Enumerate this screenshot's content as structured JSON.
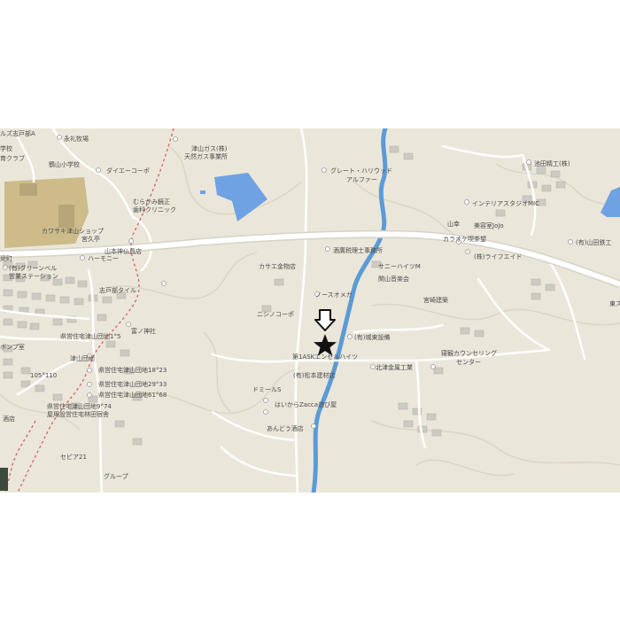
{
  "map": {
    "colors": {
      "land": "#ebe6da",
      "terrain_line": "#ddd7c9",
      "road": "#ffffff",
      "road_edge": "#d7d2c6",
      "water": "#5b9bd5",
      "pond": "#6fa2e3",
      "school": "#cdbb8a",
      "buildings": "#cdcac2",
      "boundary": "#d46b6b",
      "marker": "#111111"
    },
    "labels": {
      "l01": "ルズ志戸部A",
      "l02": "永礼牧場",
      "l03": "学校",
      "l04": "育クラブ",
      "l05": "鶴山小学校",
      "l06": "ダイエーコーポ",
      "l07": "津山ガス(株)",
      "l08": "天然ガス事業所",
      "l09": "グレート・ハリウッド",
      "l10": "アルファー",
      "l11": "池田精工(株)",
      "l12": "インテリアスタジオMIC",
      "l13": "美容室JoJo",
      "l14": "山幸",
      "l15": "むらかみ鏡正",
      "l16": "歯科クリニック",
      "l17": "カワサキ津山ショップ",
      "l18": "宮久亭",
      "l19": "酒廣税理士事務所",
      "l20": "カラオケ喫茶望",
      "l21": "(有)山田鉄工",
      "l22": "山本神仏具店",
      "l23": "奨町",
      "l24": "(有)グリーンベル",
      "l25": "ハーモニー",
      "l26": "営業ステーション",
      "l27": "カサエ金物店",
      "l28": "サニーハイツM",
      "l29": "(株)ライフエイド",
      "l30": "関山音楽会",
      "l31": "志戸部タイル",
      "l32": "ノースオメガ",
      "l33": "宮崎建築",
      "l34": "東ス",
      "l35": "ニシノコーポ",
      "l36": "富ノ神社",
      "l37": "(有)城東設備",
      "l38": "県営住宅津山団地1°5",
      "l39": "ポンプ室",
      "l40": "第1ASKエンゼルハイツ",
      "l41": "寝観カウンセリング",
      "l42": "センター",
      "l43": "津山団地",
      "l44": "県営住宅津山団地18°23",
      "l45": "北津金属工業",
      "l46": "(有)松本建材店",
      "l47": "105°110",
      "l48": "県営住宅津山団地29°33",
      "l49": "県営住宅津山団地61°68",
      "l50": "ドミールS",
      "l51": "県営住宅津山団地9°74",
      "l52": "はいからZacca遊び屋",
      "l53": "屋用設営住宅林田宿舎",
      "l54": "酒店",
      "l55": "あんどう酒店",
      "l56": "セビア21",
      "l57": "グループ"
    }
  }
}
